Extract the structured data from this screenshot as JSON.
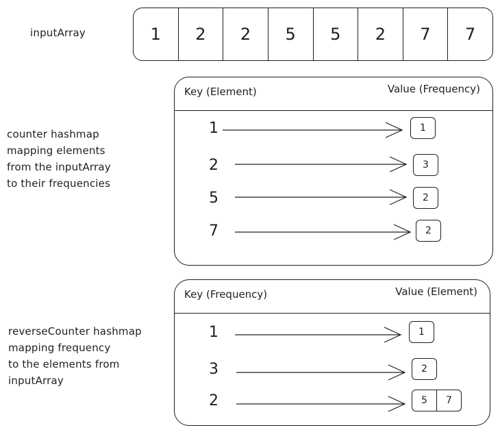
{
  "input_array": {
    "label": "inputArray",
    "values": [
      "1",
      "2",
      "2",
      "5",
      "5",
      "2",
      "7",
      "7"
    ]
  },
  "counter": {
    "description": "counter hashmap\nmapping elements\nfrom the inputArray\nto their frequencies",
    "key_header": "Key (Element)",
    "value_header": "Value (Frequency)",
    "entries": [
      {
        "key": "1",
        "values": [
          "1"
        ]
      },
      {
        "key": "2",
        "values": [
          "3"
        ]
      },
      {
        "key": "5",
        "values": [
          "2"
        ]
      },
      {
        "key": "7",
        "values": [
          "2"
        ]
      }
    ]
  },
  "reverse_counter": {
    "description": "reverseCounter hashmap\nmapping frequency\nto the elements from\ninputArray",
    "key_header": "Key (Frequency)",
    "value_header": "Value (Element)",
    "entries": [
      {
        "key": "1",
        "values": [
          "1"
        ]
      },
      {
        "key": "3",
        "values": [
          "2"
        ]
      },
      {
        "key": "2",
        "values": [
          "5",
          "7"
        ]
      }
    ]
  }
}
